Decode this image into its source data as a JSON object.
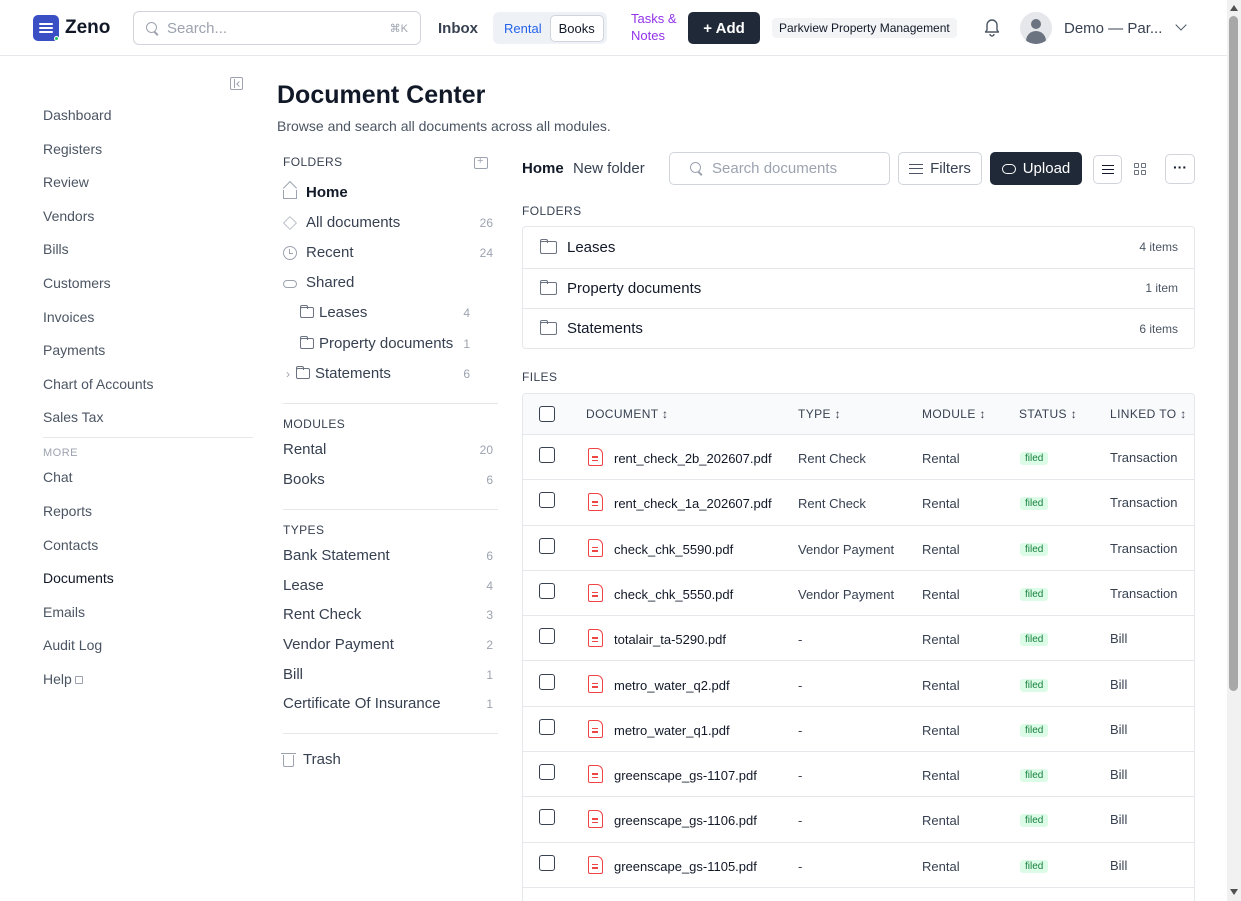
{
  "app": {
    "name": "Zeno"
  },
  "topbar": {
    "search_placeholder": "Search...",
    "search_shortcut": "⌘K",
    "inbox": "Inbox",
    "modules": [
      "Rental",
      "Books"
    ],
    "tasks_line1": "Tasks &",
    "tasks_line2": "Notes",
    "add_label": "+ Add",
    "org": "Parkview Property Management",
    "user": "Demo — Par..."
  },
  "sidebar": {
    "items": [
      "Dashboard",
      "Registers",
      "Review",
      "Vendors",
      "Bills",
      "Customers",
      "Invoices",
      "Payments",
      "Chart of Accounts",
      "Sales Tax"
    ],
    "more_label": "MORE",
    "more_items": [
      "Chat",
      "Reports",
      "Contacts",
      "Documents",
      "Emails",
      "Audit Log",
      "Help"
    ],
    "active": "Documents"
  },
  "page": {
    "title": "Document Center",
    "subtitle": "Browse and search all documents across all modules."
  },
  "folder_panel": {
    "folders_label": "FOLDERS",
    "home": "Home",
    "all_documents": {
      "label": "All documents",
      "count": "26"
    },
    "recent": {
      "label": "Recent",
      "count": "24"
    },
    "shared": "Shared",
    "shared_folders": [
      {
        "label": "Leases",
        "count": "4"
      },
      {
        "label": "Property documents",
        "count": "1"
      },
      {
        "label": "Statements",
        "count": "6"
      }
    ],
    "modules_label": "MODULES",
    "modules": [
      {
        "label": "Rental",
        "count": "20"
      },
      {
        "label": "Books",
        "count": "6"
      }
    ],
    "types_label": "TYPES",
    "types": [
      {
        "label": "Bank Statement",
        "count": "6"
      },
      {
        "label": "Lease",
        "count": "4"
      },
      {
        "label": "Rent Check",
        "count": "3"
      },
      {
        "label": "Vendor Payment",
        "count": "2"
      },
      {
        "label": "Bill",
        "count": "1"
      },
      {
        "label": "Certificate Of Insurance",
        "count": "1"
      }
    ],
    "trash": "Trash"
  },
  "toolbar": {
    "breadcrumb_home": "Home",
    "new_folder": "New folder",
    "search_placeholder": "Search documents",
    "filters": "Filters",
    "upload": "Upload",
    "more": "···"
  },
  "folders_section": {
    "label": "FOLDERS",
    "rows": [
      {
        "name": "Leases",
        "items": "4 items"
      },
      {
        "name": "Property documents",
        "items": "1 item"
      },
      {
        "name": "Statements",
        "items": "6 items"
      }
    ]
  },
  "files_section": {
    "label": "FILES",
    "columns": [
      "DOCUMENT ↕",
      "TYPE ↕",
      "MODULE ↕",
      "STATUS ↕",
      "LINKED TO ↕"
    ],
    "rows": [
      {
        "name": "rent_check_2b_202607.pdf",
        "type": "Rent Check",
        "module": "Rental",
        "status": "filed",
        "linked": "Transaction"
      },
      {
        "name": "rent_check_1a_202607.pdf",
        "type": "Rent Check",
        "module": "Rental",
        "status": "filed",
        "linked": "Transaction"
      },
      {
        "name": "check_chk_5590.pdf",
        "type": "Vendor Payment",
        "module": "Rental",
        "status": "filed",
        "linked": "Transaction"
      },
      {
        "name": "check_chk_5550.pdf",
        "type": "Vendor Payment",
        "module": "Rental",
        "status": "filed",
        "linked": "Transaction"
      },
      {
        "name": "totalair_ta-5290.pdf",
        "type": "-",
        "module": "Rental",
        "status": "filed",
        "linked": "Bill"
      },
      {
        "name": "metro_water_q2.pdf",
        "type": "-",
        "module": "Rental",
        "status": "filed",
        "linked": "Bill"
      },
      {
        "name": "metro_water_q1.pdf",
        "type": "-",
        "module": "Rental",
        "status": "filed",
        "linked": "Bill"
      },
      {
        "name": "greenscape_gs-1107.pdf",
        "type": "-",
        "module": "Rental",
        "status": "filed",
        "linked": "Bill"
      },
      {
        "name": "greenscape_gs-1106.pdf",
        "type": "-",
        "module": "Rental",
        "status": "filed",
        "linked": "Bill"
      },
      {
        "name": "greenscape_gs-1105.pdf",
        "type": "-",
        "module": "Rental",
        "status": "filed",
        "linked": "Bill"
      }
    ]
  },
  "colors": {
    "accent": "#1f2937",
    "brand": "#3b4fc4",
    "link": "#2563eb",
    "tasks": "#9333ea",
    "pdf": "#ef4444",
    "badge_bg": "#dcfce7",
    "badge_fg": "#15803d"
  }
}
